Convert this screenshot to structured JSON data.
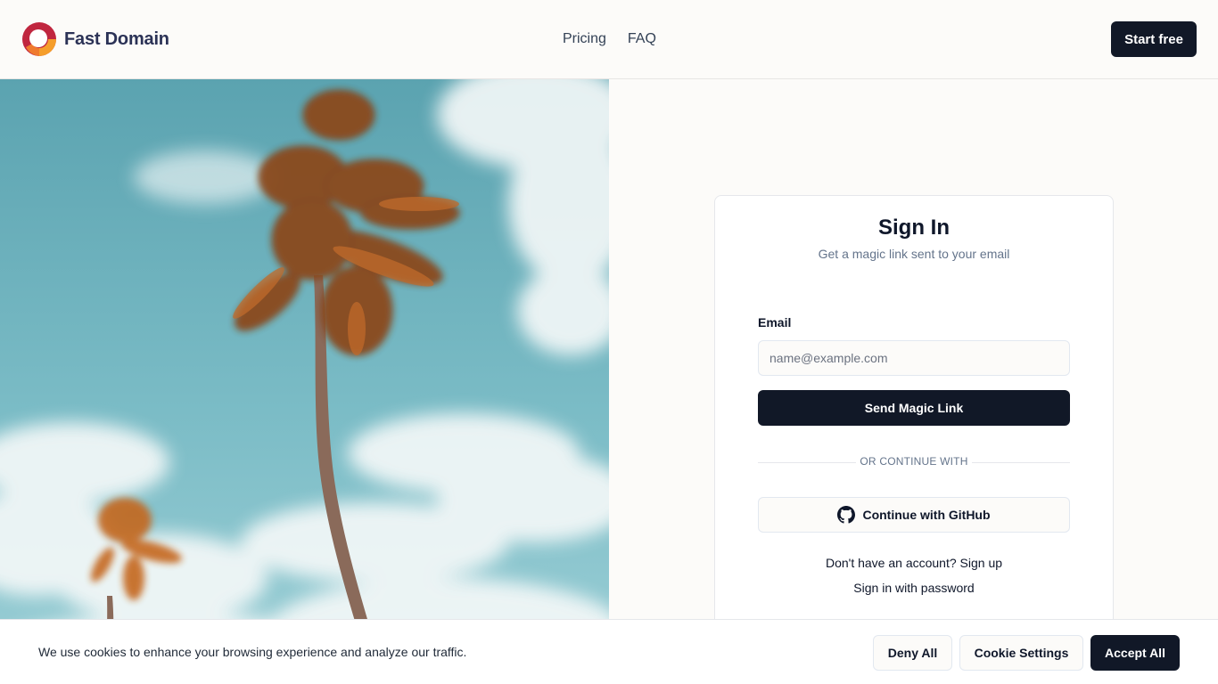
{
  "brand": {
    "name": "Fast Domain",
    "logo_icon": "ring-logo-icon"
  },
  "nav": {
    "pricing": "Pricing",
    "faq": "FAQ"
  },
  "header": {
    "start_label": "Start free"
  },
  "signin": {
    "title": "Sign In",
    "subtitle": "Get a magic link sent to your email",
    "email_label": "Email",
    "email_placeholder": "name@example.com",
    "email_value": "",
    "magic_label": "Send Magic Link",
    "divider": "OR CONTINUE WITH",
    "github_label": "Continue with GitHub",
    "github_icon": "github-icon",
    "no_account": "Don't have an account?",
    "signup": "Sign up",
    "password_link": "Sign in with password"
  },
  "cookie": {
    "text": "We use cookies to enhance your browsing experience and analyze our traffic.",
    "deny": "Deny All",
    "settings": "Cookie Settings",
    "accept": "Accept All"
  },
  "colors": {
    "primary": "#111827",
    "background": "#fcfbf9",
    "brand_text": "#2b3256",
    "logo_red": "#c0263f",
    "logo_orange": "#f59e2b",
    "sky": "#6fb3bf"
  }
}
